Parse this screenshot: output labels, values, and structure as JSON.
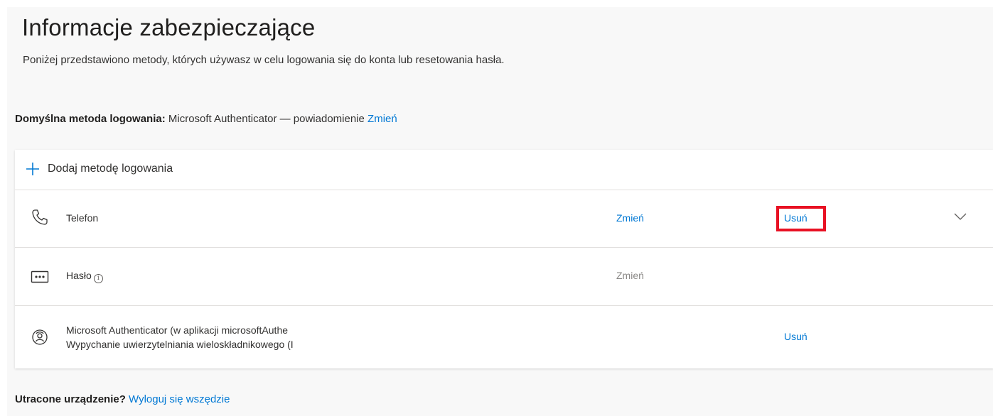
{
  "header": {
    "title": "Informacje zabezpieczające",
    "subtitle": "Poniżej przedstawiono metody, których używasz w celu logowania się do konta lub resetowania hasła."
  },
  "default_method": {
    "label": "Domyślna metoda logowania:",
    "value": "Microsoft Authenticator — powiadomienie",
    "change_link": "Zmień"
  },
  "methods": {
    "add_label": "Dodaj metodę logowania",
    "items": [
      {
        "icon": "phone-icon",
        "label": "Telefon",
        "change": "Zmień",
        "delete": "Usuń",
        "expandable": true
      },
      {
        "icon": "password-icon",
        "label": "Hasło",
        "info_icon": "i",
        "change": "Zmień",
        "change_enabled": false
      },
      {
        "icon": "authenticator-icon",
        "label_line1": "Microsoft Authenticator (w aplikacji microsoftAuthe",
        "label_line2": "Wypychanie uwierzytelniania wieloskładnikowego (I",
        "delete": "Usuń"
      }
    ]
  },
  "footer": {
    "lost_label": "Utracone urządzenie?",
    "signout_link": "Wyloguj się wszędzie"
  },
  "colors": {
    "accent": "#0078d4",
    "highlight": "#e81123",
    "disabled": "#8a8886"
  }
}
